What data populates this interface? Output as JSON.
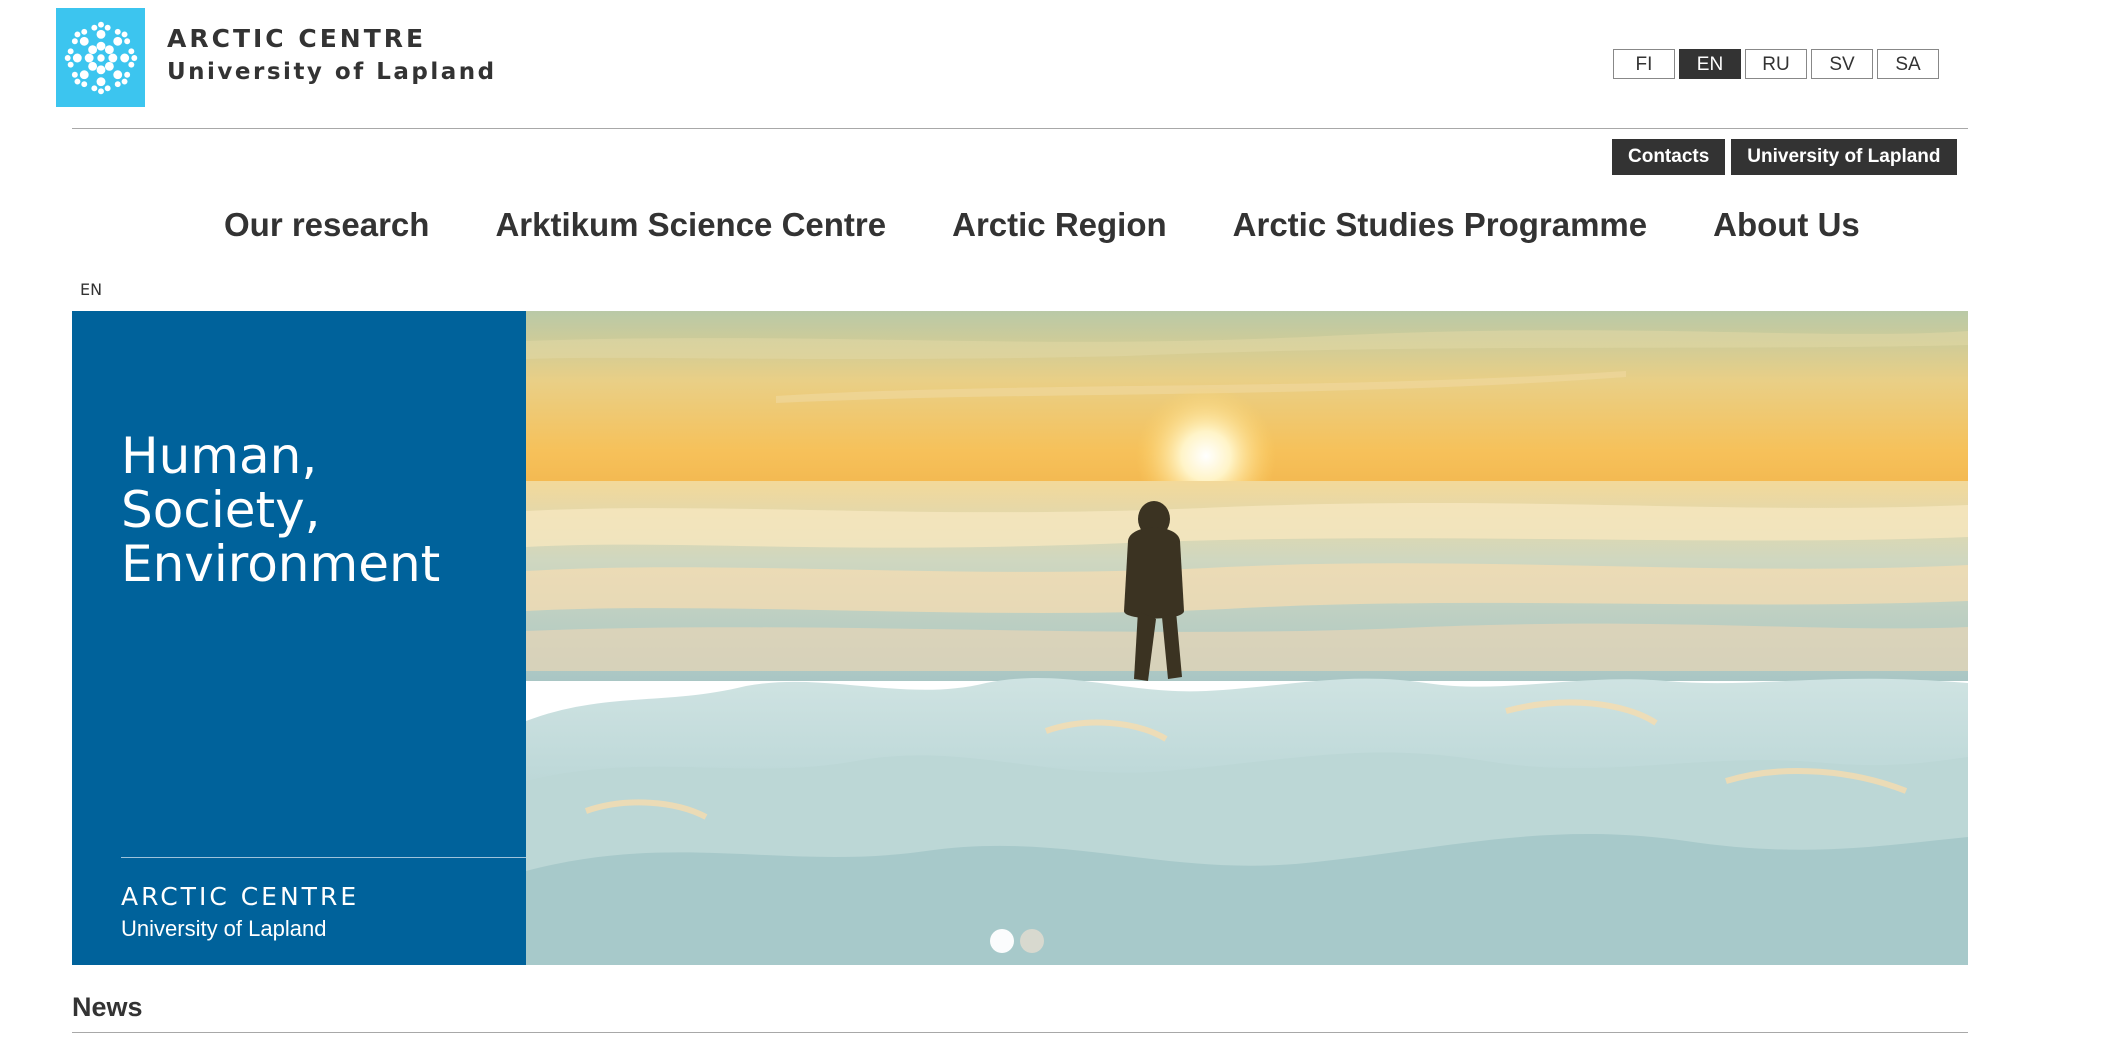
{
  "header": {
    "logo_icon": "snowflake-icon",
    "title": "ARCTIC CENTRE",
    "subtitle": "University of Lapland"
  },
  "languages": [
    {
      "label": "FI",
      "active": false
    },
    {
      "label": "EN",
      "active": true
    },
    {
      "label": "RU",
      "active": false
    },
    {
      "label": "SV",
      "active": false
    },
    {
      "label": "SA",
      "active": false
    }
  ],
  "quick_links": [
    "Contacts",
    "University of Lapland"
  ],
  "nav": [
    "Our research",
    "Arktikum Science Centre",
    "Arctic Region",
    "Arctic Studies Programme",
    "About Us"
  ],
  "current_language_label": "EN",
  "hero": {
    "heading": [
      "Human,",
      "Society,",
      "Environment"
    ],
    "brand_title": "ARCTIC CENTRE",
    "brand_subtitle": "University of Lapland",
    "slide_count": 2,
    "active_slide": 1,
    "panel_color": "#00629b"
  },
  "sections": {
    "news_title": "News"
  }
}
